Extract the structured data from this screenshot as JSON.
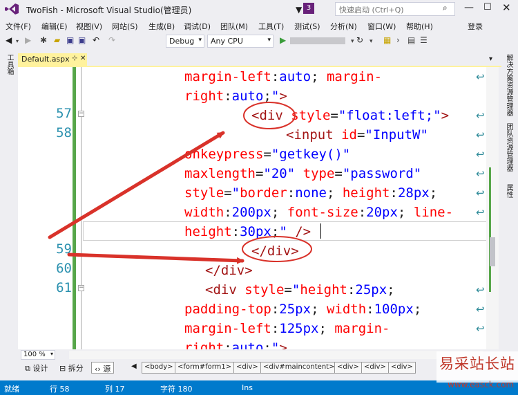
{
  "title_bar": {
    "app_title": "TwoFish - Microsoft Visual Studio(管理员)",
    "notification_count": "3",
    "quick_launch_placeholder": "快速启动 (Ctrl+Q)"
  },
  "menu": {
    "items": [
      "文件(F)",
      "编辑(E)",
      "视图(V)",
      "网站(S)",
      "生成(B)",
      "调试(D)",
      "团队(M)",
      "工具(T)",
      "测试(S)",
      "分析(N)",
      "窗口(W)",
      "帮助(H)"
    ],
    "login": "登录"
  },
  "toolbar": {
    "configuration": "Debug",
    "platform": "Any CPU"
  },
  "side_tabs": {
    "left": "工具箱",
    "right": [
      "解决方案资源管理器",
      "团队资源管理器",
      "属性"
    ]
  },
  "document_tab": {
    "name": "Default.aspx"
  },
  "editor": {
    "line_numbers": [
      "57",
      "58",
      "59",
      "60",
      "61"
    ]
  },
  "bottom": {
    "zoom": "100 %",
    "design_label": "设计",
    "split_label": "拆分",
    "source_label": "源",
    "breadcrumbs": [
      "<body>",
      "<form#form1>",
      "<div>",
      "<div#maincontent>",
      "<div>",
      "<div>",
      "<div>"
    ]
  },
  "status_bar": {
    "state": "就绪",
    "line": "行 58",
    "col": "列 17",
    "char": "字符 180",
    "mode": "Ins"
  },
  "watermark": {
    "title": "易采站长站",
    "url": "www.easck.com"
  },
  "colors": {
    "accent": "#007acc",
    "tab_active": "#fff29d",
    "tag": "#a31515",
    "attribute": "#ff0000",
    "value": "#0000ff",
    "line_number": "#2b91af",
    "annotation": "#d9322a"
  }
}
